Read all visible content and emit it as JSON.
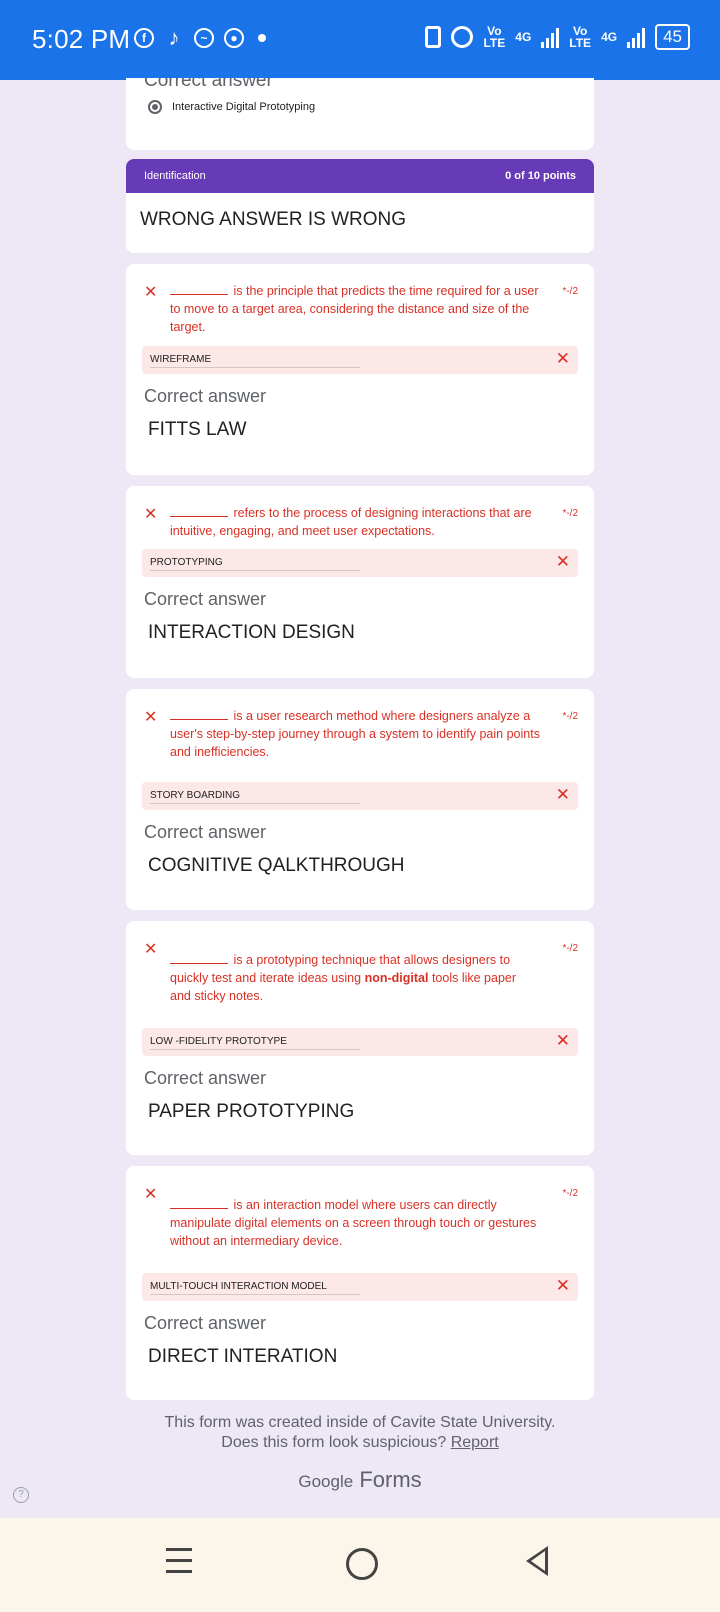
{
  "status": {
    "time": "5:02 PM",
    "apps": [
      "facebook-icon",
      "tiktok-icon",
      "messenger-icon",
      "chrome-icon",
      "dot"
    ],
    "net1_top": "Vo",
    "net1_bottom": "LTE",
    "net1_gen": "4G",
    "net2_top": "Vo",
    "net2_bottom": "LTE",
    "net2_gen": "4G",
    "battery": "45"
  },
  "prev": {
    "label": "Correct answer",
    "option": "Interactive Digital Prototyping"
  },
  "section": {
    "name": "Identification",
    "points": "0 of 10 points",
    "title": "WRONG ANSWER IS WRONG"
  },
  "questions": [
    {
      "text": "is the principle that predicts the time required for a user to move to a target area, considering the distance and size of the target.",
      "points": "*-/2",
      "answer": "WIREFRAME",
      "correct_label": "Correct answer",
      "correct": "FITTS LAW"
    },
    {
      "text": "refers to the process of designing interactions that are intuitive, engaging, and meet user expectations.",
      "points": "*-/2",
      "answer": "PROTOTYPING",
      "correct_label": "Correct answer",
      "correct": "INTERACTION DESIGN"
    },
    {
      "text": "is a user research method where designers analyze a user's step-by-step journey through a system to identify pain points and inefficiencies.",
      "points": "*-/2",
      "answer": "STORY BOARDING",
      "correct_label": "Correct answer",
      "correct": "COGNITIVE QALKTHROUGH"
    },
    {
      "text_before": "is a prototyping technique that allows designers to quickly test and iterate ideas using",
      "text_bold": "non-digital",
      "text_after": "tools like paper and sticky notes.",
      "points": "*-/2",
      "answer": "LOW -FIDELITY PROTOTYPE",
      "correct_label": "Correct answer",
      "correct": "PAPER PROTOTYPING"
    },
    {
      "text": "is an interaction model where users can directly manipulate digital elements on a screen through touch or gestures without an intermediary device.",
      "points": "*-/2",
      "answer": "MULTI-TOUCH INTERACTION MODEL",
      "correct_label": "Correct answer",
      "correct": "DIRECT INTERATION"
    }
  ],
  "footer": {
    "line1": "This form was created inside of Cavite State University.",
    "line2": "Does this form look suspicious?",
    "report": "Report",
    "brand_google": "Google",
    "brand_forms": "Forms"
  },
  "x_mark": "✕",
  "help_mark": "?"
}
